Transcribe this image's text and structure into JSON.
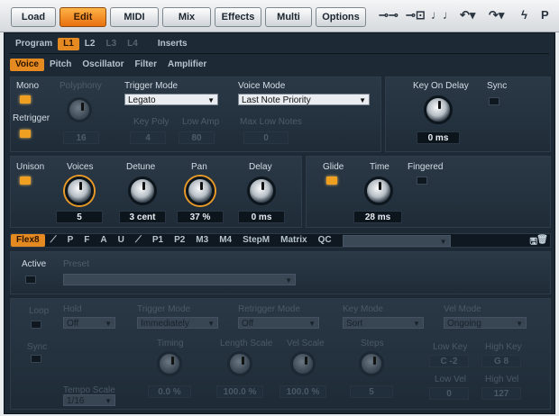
{
  "toolbar": {
    "buttons": [
      "Load",
      "Edit",
      "MIDI",
      "Mix",
      "Effects",
      "Multi",
      "Options"
    ],
    "active": "Edit",
    "icons": [
      "connect-icon",
      "link-icon",
      "note-icon",
      "undo-icon",
      "redo-icon",
      "lightning-icon",
      "p-icon"
    ],
    "icon_glyphs": [
      "⊸⊸",
      "⊸⊡",
      "♩♩",
      "↶▾",
      "↷▾",
      "ϟ",
      "P"
    ]
  },
  "program_row": {
    "label": "Program",
    "tabs": [
      "L1",
      "L2",
      "L3",
      "L4",
      "Inserts"
    ],
    "active": "L1"
  },
  "sub_tabs": {
    "items": [
      "Voice",
      "Pitch",
      "Oscillator",
      "Filter",
      "Amplifier"
    ],
    "active": "Voice"
  },
  "voice": {
    "mono_label": "Mono",
    "polyphony_label": "Polyphony",
    "polyphony_value": "16",
    "retrigger_label": "Retrigger",
    "trigger_mode_label": "Trigger Mode",
    "trigger_mode_value": "Legato",
    "key_poly_label": "Key Poly",
    "key_poly_value": "4",
    "low_amp_label": "Low Amp",
    "low_amp_value": "80",
    "voice_mode_label": "Voice Mode",
    "voice_mode_value": "Last Note Priority",
    "max_lo_label": "Max Low Notes",
    "max_lo_value": "0",
    "key_on_delay_label": "Key On Delay",
    "key_on_delay_value": "0 ms",
    "sync_label": "Sync"
  },
  "unison": {
    "unison_label": "Unison",
    "voices_label": "Voices",
    "voices_value": "5",
    "detune_label": "Detune",
    "detune_value": "3 cent",
    "pan_label": "Pan",
    "pan_value": "37 %",
    "delay_label": "Delay",
    "delay_value": "0 ms",
    "glide_label": "Glide",
    "time_label": "Time",
    "time_value": "28 ms",
    "fingered_label": "Fingered"
  },
  "mod_tabs": {
    "items": [
      "Flex8",
      "⟋",
      "P",
      "F",
      "A",
      "U",
      "⟋",
      "P1",
      "P2",
      "M3",
      "M4",
      "StepM",
      "Matrix",
      "QC"
    ],
    "active": "Flex8",
    "dropdown_value": "",
    "icons": [
      "save-icon",
      "delete-icon"
    ],
    "icon_glyphs": [
      "🖫",
      "🗑"
    ]
  },
  "mod": {
    "active_label": "Active",
    "preset_label": "Preset",
    "preset_value": "",
    "loop_label": "Loop",
    "sync_label": "Sync",
    "hold_label": "Hold",
    "hold_value": "Off",
    "trigger_mode_label": "Trigger Mode",
    "trigger_mode_value": "Immediately",
    "retrigger_mode_label": "Retrigger Mode",
    "retrigger_mode_value": "Off",
    "key_mode_label": "Key Mode",
    "key_mode_value": "Sort",
    "vel_mode_label": "Vel Mode",
    "vel_mode_value": "Ongoing",
    "timing_label": "Timing",
    "timing_value": "0.0 %",
    "length_label": "Length Scale",
    "length_value": "100.0 %",
    "vel_scale_label": "Vel Scale",
    "vel_scale_value": "100.0 %",
    "steps_label": "Steps",
    "steps_value": "5",
    "low_key_label": "Low Key",
    "low_key_value": "C -2",
    "high_key_label": "High Key",
    "high_key_value": "G 8",
    "low_vel_label": "Low Vel",
    "low_vel_value": "0",
    "high_vel_label": "High Vel",
    "high_vel_value": "127",
    "tempo_label": "Tempo Scale",
    "tempo_value": "1/16"
  },
  "colors": {
    "accent": "#e58a21",
    "panel": "#1d2935"
  }
}
